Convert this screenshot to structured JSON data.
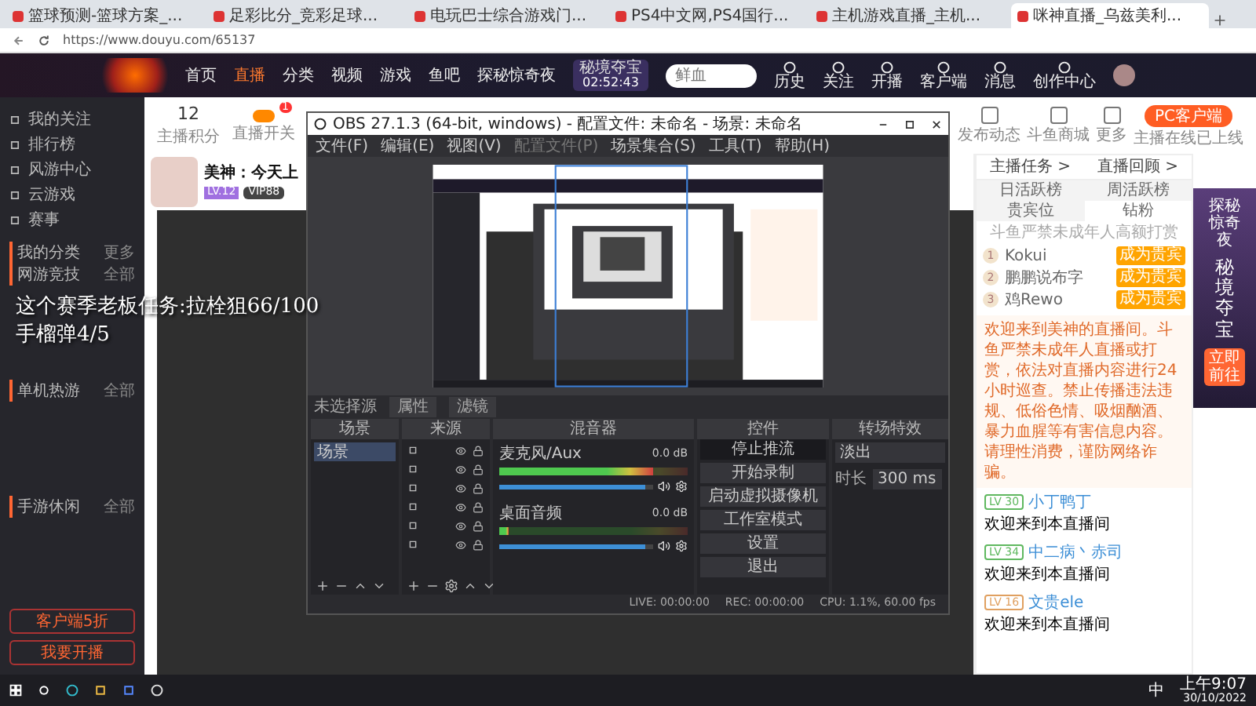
{
  "browser": {
    "tabs": [
      {
        "title": "篮球预测-篮球方案_...",
        "selected": false
      },
      {
        "title": "足彩比分_竞彩足球...",
        "selected": false
      },
      {
        "title": "电玩巴士综合游戏门...",
        "selected": false
      },
      {
        "title": "PS4中文网,PS4国行...",
        "selected": false
      },
      {
        "title": "主机游戏直播_主机...",
        "selected": false
      },
      {
        "title": "咪神直播_乌兹美利...",
        "selected": true
      }
    ],
    "url": "https://www.douyu.com/65137"
  },
  "header": {
    "nav": [
      {
        "label": "首页",
        "selected": false
      },
      {
        "label": "直播",
        "selected": true
      },
      {
        "label": "分类",
        "selected": false
      },
      {
        "label": "视频",
        "selected": false
      },
      {
        "label": "游戏",
        "selected": false
      },
      {
        "label": "鱼吧",
        "selected": false
      },
      {
        "label": "探秘惊奇夜",
        "selected": false
      }
    ],
    "event": {
      "label": "秘境夺宝",
      "time": "02:52:43"
    },
    "search": {
      "placeholder": "鲜血"
    },
    "actions": [
      "历史",
      "关注",
      "开播",
      "客户端",
      "消息",
      "创作中心"
    ]
  },
  "sidebar": {
    "items": [
      "我的关注",
      "排行榜",
      "风游中心",
      "云游戏",
      "赛事"
    ],
    "sections": [
      {
        "title": "我的分类",
        "more": "更多"
      },
      {
        "title": "网游竞技",
        "more": "全部"
      },
      {
        "title": "单机热游",
        "more": "全部"
      },
      {
        "title": "手游休闲",
        "more": "全部"
      }
    ],
    "buttons": [
      "客户端5折",
      "我要开播"
    ]
  },
  "toolbar": {
    "score": "12",
    "score_label": "主播积分",
    "switch_label": "直播开关",
    "badge": "1",
    "right_items": [
      "发布动态",
      "斗鱼商城",
      "更多"
    ],
    "client_button": "PC客户端",
    "client_note": "主播在线已上线"
  },
  "streamer": {
    "title": "美神：今天上",
    "level": "LV.12",
    "tag": "VIP88"
  },
  "overlay": {
    "line1": "这个赛季老板任务:拉栓狙66/100",
    "line2": "手榴弹4/5"
  },
  "obs": {
    "title": "OBS 27.1.3 (64-bit, windows) - 配置文件: 未命名 - 场景: 未命名",
    "menu": [
      {
        "label": "文件(F)",
        "disabled": false
      },
      {
        "label": "编辑(E)",
        "disabled": false
      },
      {
        "label": "视图(V)",
        "disabled": false
      },
      {
        "label": "配置文件(P)",
        "disabled": true
      },
      {
        "label": "场景集合(S)",
        "disabled": false
      },
      {
        "label": "工具(T)",
        "disabled": false
      },
      {
        "label": "帮助(H)",
        "disabled": false
      }
    ],
    "source_bar": {
      "label": "未选择源",
      "buttons": [
        "属性",
        "滤镜"
      ]
    },
    "docks": {
      "scenes": "场景",
      "sources": "来源",
      "mixer": "混音器",
      "controls": "控件",
      "transitions": "转场特效"
    },
    "scenes": [
      {
        "name": "场景",
        "selected": true
      }
    ],
    "channels": [
      {
        "name": "麦克风/Aux",
        "reading": "0.0 dB",
        "level": 0.82,
        "fader": {
          "level": 0.95
        }
      },
      {
        "name": "桌面音频",
        "reading": "0.0 dB",
        "level": 0.05,
        "fader": {
          "level": 0.95
        }
      }
    ],
    "controls": [
      {
        "label": "停止推流",
        "active": true
      },
      {
        "label": "开始录制",
        "active": false
      },
      {
        "label": "启动虚拟摄像机",
        "active": false
      },
      {
        "label": "工作室模式",
        "active": false
      },
      {
        "label": "设置",
        "active": false
      },
      {
        "label": "退出",
        "active": false
      }
    ],
    "transition": {
      "value": "淡出",
      "duration_label": "时长",
      "duration": "300 ms"
    },
    "status": [
      "LIVE: 00:00:00",
      "REC: 00:00:00",
      "CPU: 1.1%, 60.00 fps"
    ]
  },
  "right": {
    "tasks": [
      "主播任务 >",
      "直播回顾 >"
    ],
    "tabs": [
      {
        "label": "日活跃榜",
        "selected": false
      },
      {
        "label": "周活跃榜",
        "selected": false
      },
      {
        "label": "贵宾位",
        "selected": false
      },
      {
        "label": "钻粉",
        "selected": true
      }
    ],
    "rank_note": "斗鱼严禁未成年人高额打赏",
    "ranks": [
      {
        "rank": "1",
        "name": "Kokui",
        "action": "成为贵宾"
      },
      {
        "rank": "2",
        "name": "鹏鹏说布字",
        "action": "成为贵宾"
      },
      {
        "rank": "3",
        "name": "鸡Rewo",
        "action": "成为贵宾"
      }
    ],
    "notice": "欢迎来到美神的直播间。斗鱼严禁未成年人直播或打赏，依法对直播内容进行24小时巡查。禁止传播违法违规、低俗色情、吸烟酗酒、暴力血腥等有害信息内容。请理性消费，谨防网络诈骗。",
    "messages": [
      {
        "level": "LV 30",
        "color": "#5fb85f",
        "user": "小丁鸭丁",
        "text": "欢迎来到本直播间"
      },
      {
        "level": "LV 34",
        "color": "#5fb85f",
        "user": "中二病丶赤司",
        "text": "欢迎来到本直播间"
      },
      {
        "level": "LV 16",
        "color": "#e0a060",
        "user": "文贵ele",
        "text": "欢迎来到本直播间"
      }
    ],
    "ad": {
      "title": "探秘惊奇夜",
      "subtitle": "秘境夺宝",
      "button": "立即前往"
    }
  },
  "taskbar": {
    "time": "上午9:07",
    "date": "30/10/2022",
    "ime": "中"
  }
}
